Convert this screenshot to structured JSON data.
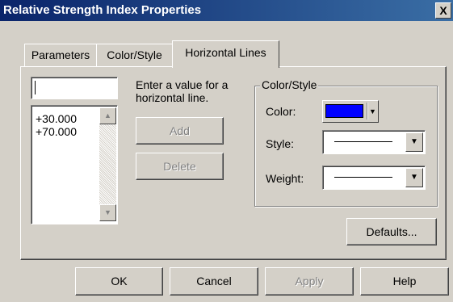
{
  "window": {
    "title": "Relative Strength Index Properties",
    "close_glyph": "X"
  },
  "tabs": [
    {
      "label": "Parameters"
    },
    {
      "label": "Color/Style"
    },
    {
      "label": "Horizontal Lines",
      "active": true
    }
  ],
  "horizontal_lines": {
    "value_input": "",
    "list_items": [
      "+30.000",
      "+70.000"
    ],
    "instruction": [
      "Enter a value for a",
      "horizontal line."
    ],
    "add_label": "Add",
    "delete_label": "Delete"
  },
  "color_style": {
    "title": "Color/Style",
    "color_label": "Color:",
    "color_value": "#0000ff",
    "style_label": "Style:",
    "weight_label": "Weight:"
  },
  "defaults_label": "Defaults...",
  "footer": {
    "ok_label": "OK",
    "cancel_label": "Cancel",
    "apply_label": "Apply",
    "help_label": "Help"
  },
  "icons": {
    "up": "▲",
    "down": "▼",
    "dropdown": "▼"
  }
}
